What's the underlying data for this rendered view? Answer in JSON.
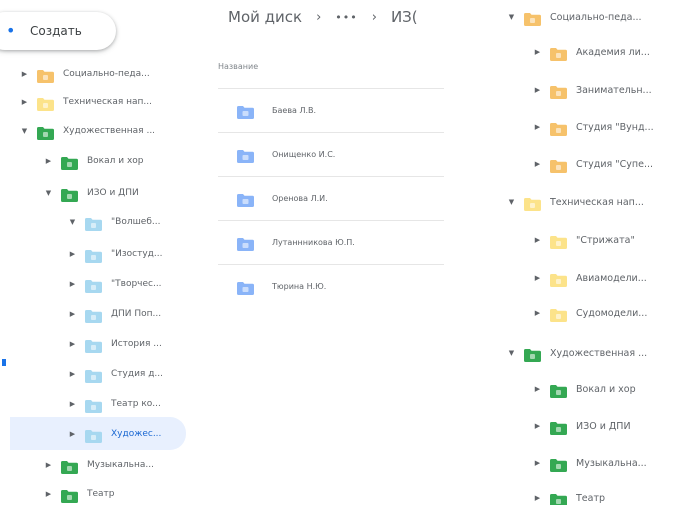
{
  "colors": {
    "folder_blue": "#8ab4f8",
    "folder_orange": "#f6c26b",
    "folder_yellow": "#fce38a",
    "folder_green": "#34a853",
    "folder_teal": "#a7d8f0",
    "accent": "#1a73e8",
    "selected_bg": "#e8f0fe"
  },
  "sidebar": {
    "create_label": "Создать",
    "tree": [
      {
        "label": "Социально-педа...",
        "arrow": "collapsed",
        "color": "#f6c26b",
        "icon": "folder-icon"
      },
      {
        "label": "Техническая нап...",
        "arrow": "collapsed",
        "color": "#fce38a",
        "icon": "folder-icon"
      },
      {
        "label": "Художественная ...",
        "arrow": "expanded",
        "color": "#34a853",
        "icon": "folder-icon"
      },
      {
        "label": "Вокал и хор",
        "arrow": "collapsed",
        "color": "#34a853",
        "icon": "folder-icon"
      },
      {
        "label": "ИЗО и ДПИ",
        "arrow": "expanded",
        "color": "#34a853",
        "icon": "folder-icon"
      },
      {
        "label": "\"Волшеб...",
        "arrow": "expanded",
        "color": "#a7d8f0",
        "icon": "folder-icon"
      },
      {
        "label": "\"Изостуд...",
        "arrow": "collapsed",
        "color": "#a7d8f0",
        "icon": "folder-icon"
      },
      {
        "label": "\"Творчес...",
        "arrow": "collapsed",
        "color": "#a7d8f0",
        "icon": "folder-icon"
      },
      {
        "label": "ДПИ Поп...",
        "arrow": "collapsed",
        "color": "#a7d8f0",
        "icon": "folder-icon"
      },
      {
        "label": "История ...",
        "arrow": "collapsed",
        "color": "#a7d8f0",
        "icon": "folder-icon"
      },
      {
        "label": "Студия д...",
        "arrow": "collapsed",
        "color": "#a7d8f0",
        "icon": "folder-icon"
      },
      {
        "label": "Театр ко...",
        "arrow": "collapsed",
        "color": "#a7d8f0",
        "icon": "folder-icon"
      },
      {
        "label": "Художес...",
        "arrow": "collapsed",
        "color": "#a7d8f0",
        "icon": "folder-icon",
        "selected": true
      },
      {
        "label": "Музыкальна...",
        "arrow": "collapsed",
        "color": "#34a853",
        "icon": "folder-icon"
      },
      {
        "label": "Театр",
        "arrow": "collapsed",
        "color": "#34a853",
        "icon": "folder-icon"
      }
    ]
  },
  "main": {
    "breadcrumb": {
      "root": "Мой диск",
      "more": "•••",
      "current": "ИЗ("
    },
    "column_header": "Название",
    "files": [
      {
        "name": "Баева Л.В.",
        "icon": "shared-folder-icon"
      },
      {
        "name": "Онищенко И.С.",
        "icon": "shared-folder-icon"
      },
      {
        "name": "Оренова Л.И.",
        "icon": "shared-folder-icon"
      },
      {
        "name": "Лутаннникова Ю.П.",
        "icon": "shared-folder-icon"
      },
      {
        "name": "Тюрина Н.Ю.",
        "icon": "shared-folder-icon"
      }
    ]
  },
  "right_tree": [
    {
      "label": "Социально-педа...",
      "arrow": "expanded",
      "color": "#f6c26b",
      "icon": "folder-icon"
    },
    {
      "label": "Академия ли...",
      "arrow": "collapsed",
      "color": "#f6c26b",
      "icon": "folder-icon"
    },
    {
      "label": "Занимательн...",
      "arrow": "collapsed",
      "color": "#f6c26b",
      "icon": "folder-icon"
    },
    {
      "label": "Студия \"Вунд...",
      "arrow": "collapsed",
      "color": "#f6c26b",
      "icon": "folder-icon"
    },
    {
      "label": "Студия \"Супе...",
      "arrow": "collapsed",
      "color": "#f6c26b",
      "icon": "folder-icon"
    },
    {
      "label": "Техническая нап...",
      "arrow": "expanded",
      "color": "#fce38a",
      "icon": "folder-icon"
    },
    {
      "label": "\"Стрижата\"",
      "arrow": "collapsed",
      "color": "#fce38a",
      "icon": "folder-icon"
    },
    {
      "label": "Авиамодели...",
      "arrow": "collapsed",
      "color": "#fce38a",
      "icon": "folder-icon"
    },
    {
      "label": "Судомодели...",
      "arrow": "collapsed",
      "color": "#fce38a",
      "icon": "folder-icon"
    },
    {
      "label": "Художественная ...",
      "arrow": "expanded",
      "color": "#34a853",
      "icon": "folder-icon"
    },
    {
      "label": "Вокал и хор",
      "arrow": "collapsed",
      "color": "#34a853",
      "icon": "folder-icon"
    },
    {
      "label": "ИЗО и ДПИ",
      "arrow": "collapsed",
      "color": "#34a853",
      "icon": "folder-icon"
    },
    {
      "label": "Музыкальна...",
      "arrow": "collapsed",
      "color": "#34a853",
      "icon": "folder-icon"
    },
    {
      "label": "Театр",
      "arrow": "collapsed",
      "color": "#34a853",
      "icon": "folder-icon"
    }
  ]
}
